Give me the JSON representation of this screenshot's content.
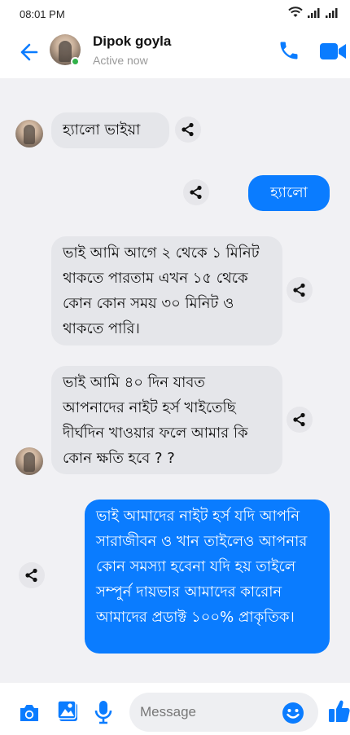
{
  "status_bar": {
    "time": "08:01 PM"
  },
  "header": {
    "contact_name": "Dipok goyla",
    "status": "Active now"
  },
  "messages": [
    {
      "direction": "incoming",
      "text": "হ্যালো ভাইয়া"
    },
    {
      "direction": "outgoing",
      "text": "হ্যালো"
    },
    {
      "direction": "incoming",
      "lines": [
        "ভাই আমি আগে ২ থেকে ১ মিনিট",
        "থাকতে পারতাম এখন ১৫ থেকে",
        "কোন কোন সময় ৩০ মিনিট ও",
        "থাকতে পারি।"
      ]
    },
    {
      "direction": "incoming",
      "lines": [
        "ভাই আমি ৪০ দিন যাবত",
        "আপনাদের নাইট হর্স খাইতেছি",
        "দীর্ঘদিন খাওয়ার ফলে আমার কি",
        "কোন ক্ষতি হবে ? ?"
      ]
    },
    {
      "direction": "outgoing",
      "lines": [
        "ভাই আমাদের নাইট হর্স যদি আপনি",
        "সারাজীবন ও খান তাইলেও আপনার",
        "কোন সমস্যা হবেনা যদি হয় তাইলে",
        "সম্পুর্ন দায়ভার আমাদের কারোন",
        "আমাদের প্রডাক্ট ১০০% প্রাকৃতিক।"
      ]
    }
  ],
  "composer": {
    "placeholder": "Message"
  },
  "colors": {
    "accent": "#0a7cff",
    "incoming_bubble": "#e5e6ea",
    "online": "#31b24a"
  },
  "icons": [
    "back-arrow-icon",
    "phone-icon",
    "video-camera-icon",
    "share-icon",
    "camera-icon",
    "gallery-icon",
    "microphone-icon",
    "emoji-icon",
    "thumbs-up-icon",
    "wifi-icon",
    "signal-icon"
  ]
}
